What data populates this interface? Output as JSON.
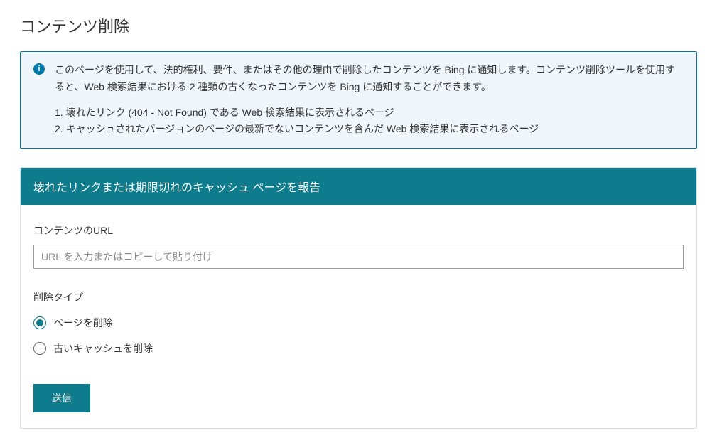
{
  "page": {
    "title": "コンテンツ削除"
  },
  "info": {
    "intro": "このページを使用して、法的権利、要件、またはその他の理由で削除したコンテンツを Bing に通知します。コンテンツ削除ツールを使用すると、Web 検索結果における 2 種類の古くなったコンテンツを Bing に通知することができます。",
    "items": [
      "1. 壊れたリンク (404 - Not Found) である Web 検索結果に表示されるページ",
      "2. キャッシュされたバージョンのページの最新でないコンテンツを含んだ Web 検索結果に表示されるページ"
    ]
  },
  "form": {
    "header": "壊れたリンクまたは期限切れのキャッシュ ページを報告",
    "url_label": "コンテンツのURL",
    "url_placeholder": "URL を入力またはコピーして貼り付け",
    "url_value": "",
    "removal_type_label": "削除タイプ",
    "options": {
      "remove_page": "ページを削除",
      "remove_cache": "古いキャッシュを削除"
    },
    "selected_option": "remove_page",
    "submit_label": "送信"
  }
}
